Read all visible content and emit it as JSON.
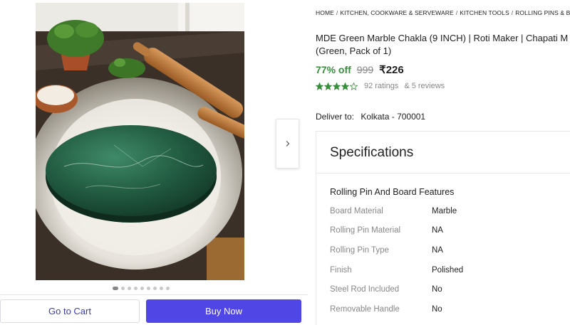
{
  "breadcrumb": [
    "HOME",
    "KITCHEN, COOKWARE & SERVEWARE",
    "KITCHEN TOOLS",
    "ROLLING PINS & BOARDS",
    ""
  ],
  "product": {
    "title_line1": "MDE Green Marble Chakla (9 INCH) | Roti Maker | Chapati M",
    "title_line2": "(Green, Pack of 1)",
    "discount": "77% off",
    "mrp": "999",
    "price": "₹226",
    "rating_stars": 4,
    "ratings": "92 ratings",
    "reviews": "& 5 reviews"
  },
  "gallery": {
    "image_count": 9,
    "active_index": 0,
    "next_icon": "chevron-right-icon"
  },
  "actions": {
    "cart_label": "Go to Cart",
    "buy_label": "Buy Now"
  },
  "delivery": {
    "label": "Deliver to:",
    "location": "Kolkata - 700001"
  },
  "specifications": {
    "heading": "Specifications",
    "group_title": "Rolling Pin And Board Features",
    "rows": [
      {
        "key": "Board Material",
        "value": "Marble"
      },
      {
        "key": "Rolling Pin Material",
        "value": "NA"
      },
      {
        "key": "Rolling Pin Type",
        "value": "NA"
      },
      {
        "key": "Finish",
        "value": "Polished"
      },
      {
        "key": "Steel Rod Included",
        "value": "No"
      },
      {
        "key": "Removable Handle",
        "value": "No"
      }
    ]
  },
  "colors": {
    "discount": "#388e3c",
    "star": "#388e3c",
    "buy_button": "#4f46e5",
    "cart_text": "#3b3bb3"
  }
}
